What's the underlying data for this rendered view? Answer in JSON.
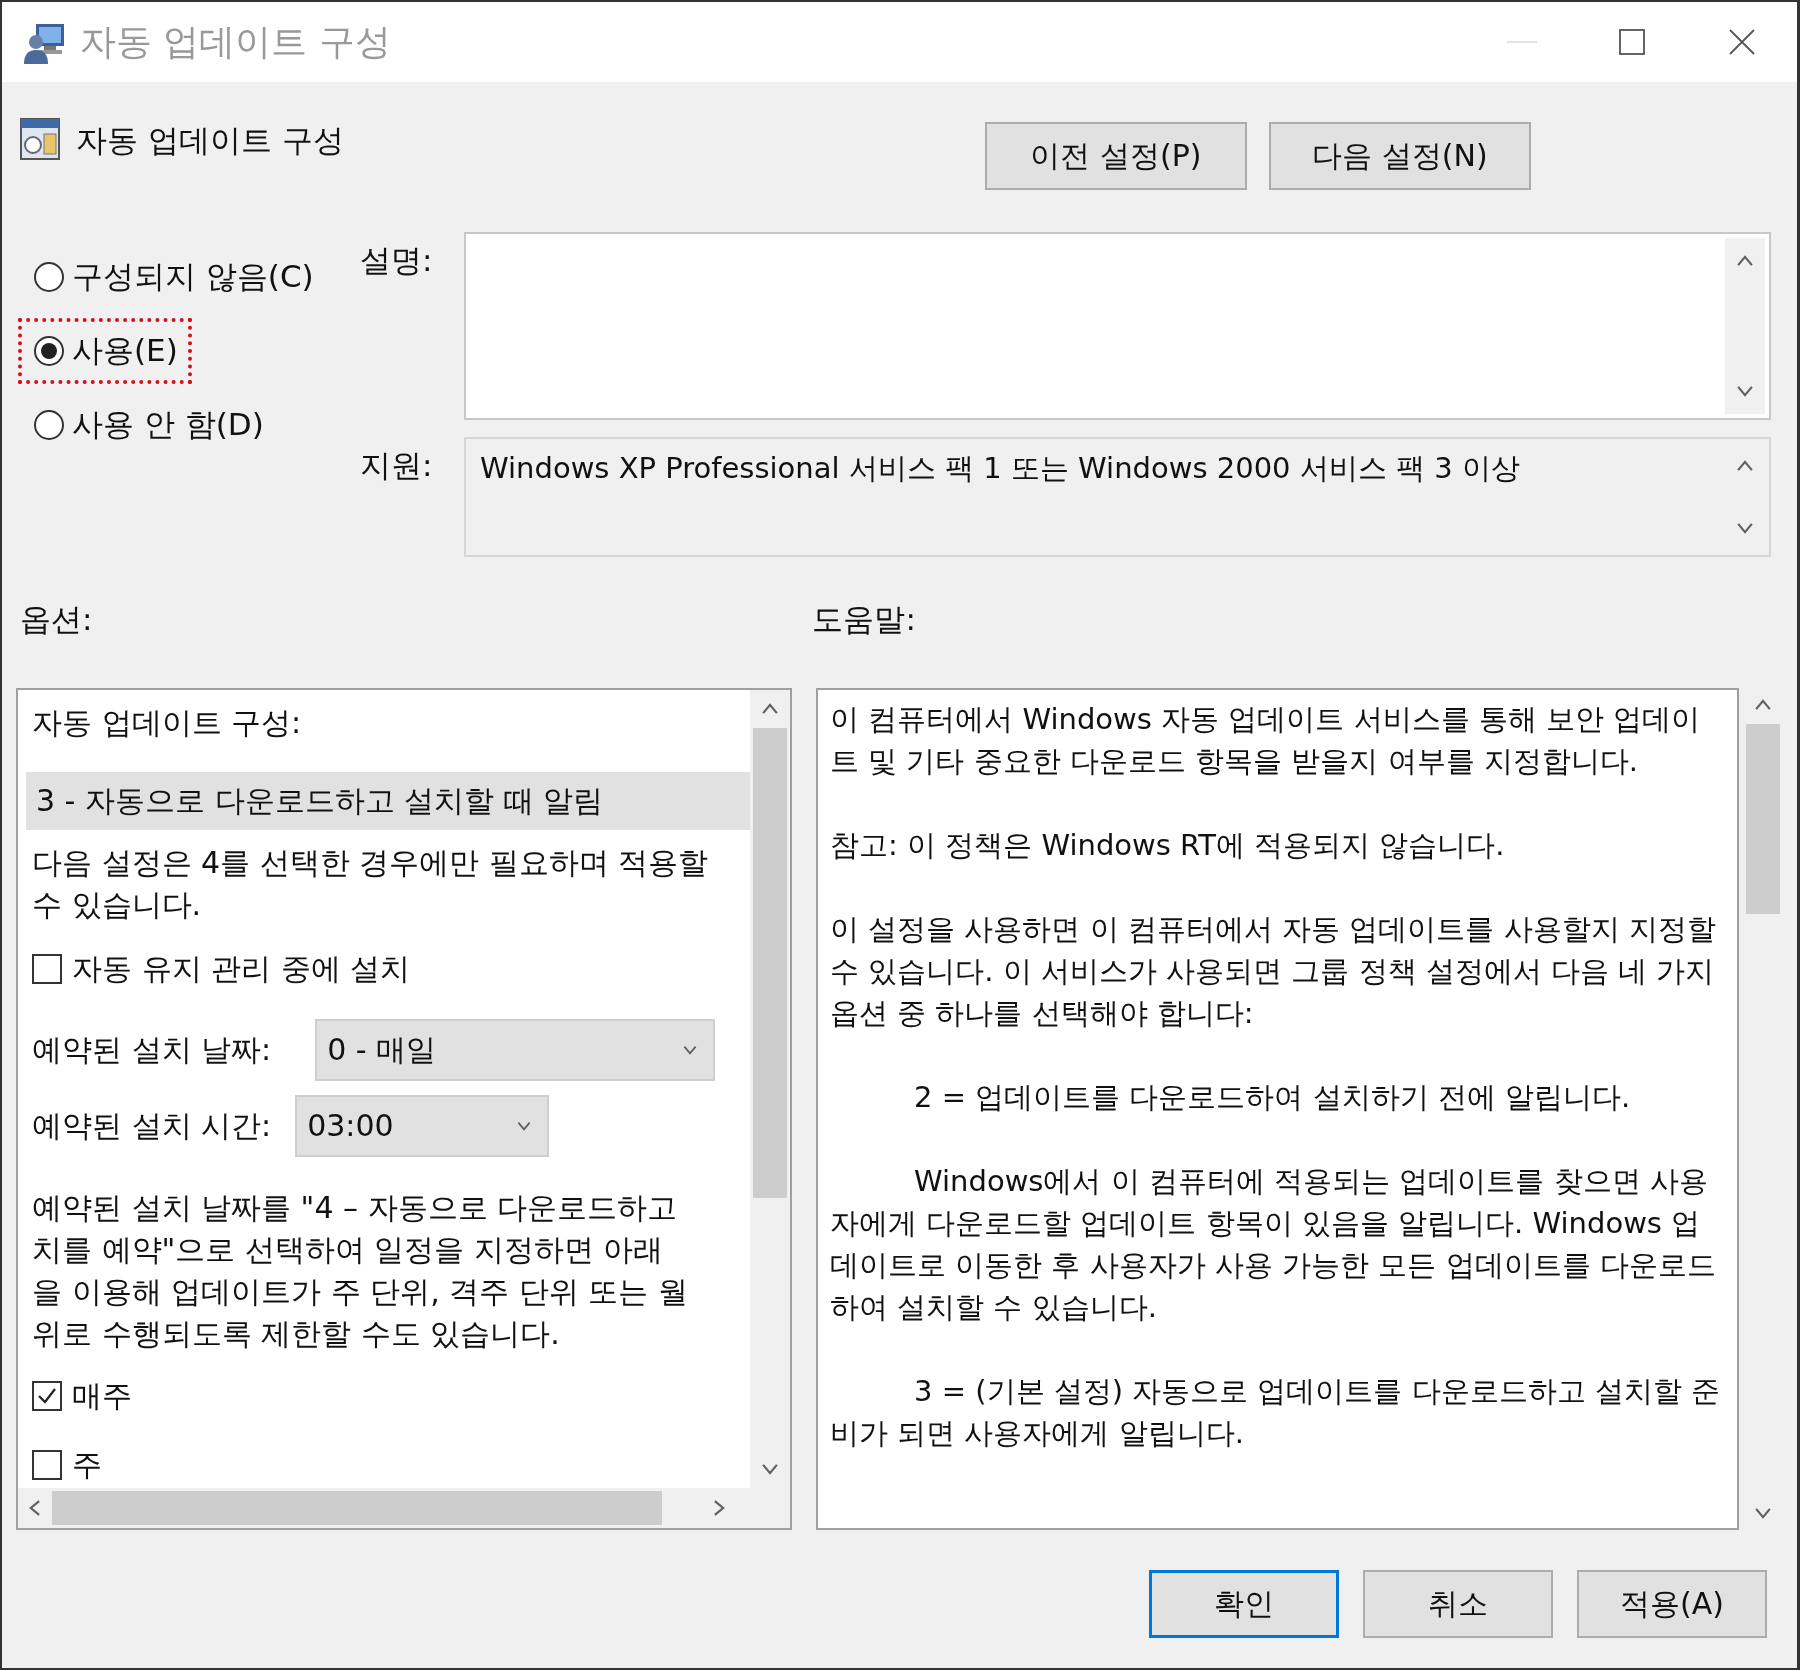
{
  "window": {
    "title": "자동 업데이트 구성"
  },
  "header": {
    "title": "자동 업데이트 구성"
  },
  "nav_buttons": [
    {
      "label": "이전 설정(P)"
    },
    {
      "label": "다음 설정(N)"
    }
  ],
  "state_options": [
    {
      "label": "구성되지 않음(C)",
      "selected": false,
      "annotated": false
    },
    {
      "label": "사용(E)",
      "selected": true,
      "annotated": true
    },
    {
      "label": "사용 안 함(D)",
      "selected": false,
      "annotated": false
    }
  ],
  "description": {
    "label": "설명:"
  },
  "support": {
    "label": "지원:",
    "text": "Windows XP Professional 서비스 팩 1 또는 Windows 2000 서비스 팩 3 이상"
  },
  "options": {
    "label": "옵션:",
    "items": [
      {
        "kind": "text",
        "text": "자동 업데이트 구성:"
      },
      {
        "kind": "select",
        "value": "3 - 자동으로 다운로드하고 설치할 때 알림"
      },
      {
        "kind": "text",
        "text": "다음 설정은 4를 선택한 경우에만 필요하며 적용할 수 있습니다."
      },
      {
        "kind": "checkbox",
        "label": "자동 유지 관리 중에 설치",
        "checked": false
      },
      {
        "kind": "combo",
        "label": "예약된 설치 날짜:",
        "value": "0 - 매일",
        "wide": true
      },
      {
        "kind": "combo",
        "label": "예약된 설치 시간:",
        "value": "03:00",
        "wide": false
      },
      {
        "kind": "lines",
        "lines": [
          "예약된 설치 날짜를 \"4 – 자동으로 다운로드하고",
          "치를 예약\"으로 선택하여 일정을 지정하면 아래",
          "을 이용해 업데이트가 주 단위, 격주 단위 또는 월",
          "위로 수행되도록 제한할 수도 있습니다."
        ]
      },
      {
        "kind": "checkbox",
        "label": "매주",
        "checked": true
      },
      {
        "kind": "checkbox",
        "label": "주",
        "checked": false
      }
    ]
  },
  "help": {
    "label": "도움말:",
    "paragraphs": [
      {
        "text": "이 컴퓨터에서 Windows 자동 업데이트 서비스를 통해 보안 업데이트 및 기타 중요한 다운로드 항목을 받을지 여부를 지정합니다.",
        "indent": false
      },
      {
        "text": "참고: 이 정책은 Windows RT에 적용되지 않습니다.",
        "indent": false
      },
      {
        "text": "이 설정을 사용하면 이 컴퓨터에서 자동 업데이트를 사용할지 지정할 수 있습니다. 이 서비스가 사용되면 그룹 정책 설정에서 다음 네 가지 옵션 중 하나를 선택해야 합니다:",
        "indent": false
      },
      {
        "text": "2 = 업데이트를 다운로드하여 설치하기 전에 알립니다.",
        "indent": true
      },
      {
        "text": "Windows에서 이 컴퓨터에 적용되는 업데이트를 찾으면 사용자에게 다운로드할 업데이트 항목이 있음을 알립니다. Windows 업데이트로 이동한 후 사용자가 사용 가능한 모든 업데이트를 다운로드하여 설치할 수 있습니다.",
        "indent": true
      },
      {
        "text": "3 = (기본 설정) 자동으로 업데이트를 다운로드하고 설치할 준비가 되면 사용자에게 알립니다.",
        "indent": true
      }
    ]
  },
  "footer_buttons": [
    {
      "label": "확인",
      "default": true
    },
    {
      "label": "취소",
      "default": false
    },
    {
      "label": "적용(A)",
      "default": false
    }
  ]
}
